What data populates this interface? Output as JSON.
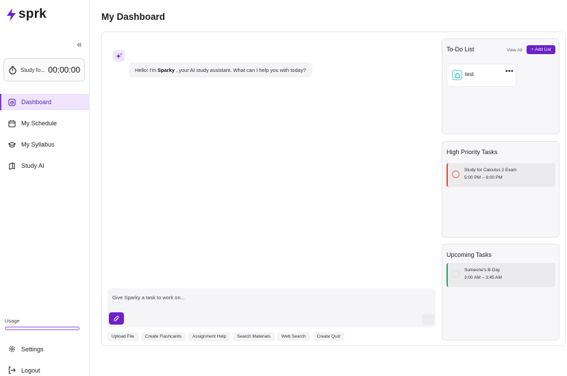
{
  "app": {
    "name": "sprk"
  },
  "sidebar": {
    "timer": {
      "label": "Study fo...",
      "value": "00:00:00"
    },
    "items": [
      {
        "label": "Dashboard",
        "icon": "dashboard-icon",
        "active": true
      },
      {
        "label": "My Schedule",
        "icon": "calendar-icon",
        "active": false
      },
      {
        "label": "My Syllabus",
        "icon": "graduation-cap-icon",
        "active": false
      },
      {
        "label": "Study AI",
        "icon": "book-icon",
        "active": false
      }
    ],
    "usage": {
      "label": "Usage",
      "fraction": 0.0
    },
    "settings_label": "Settings",
    "logout_label": "Logout"
  },
  "page": {
    "title": "My Dashboard"
  },
  "chat": {
    "greeting_prefix": "Hello! I'm",
    "assistant_name": "Sparky",
    "greeting_suffix": ", your AI study assistant. What can I help you with today?",
    "input_placeholder": "Give Sparky a task to work on...",
    "quick_actions": [
      "Upload File",
      "Create Flashcards",
      "Assignment Help",
      "Search Materials",
      "Web Search",
      "Create Quiz"
    ]
  },
  "todo": {
    "title": "To-Do List",
    "view_all_label": "View All",
    "add_list_label": "Add List",
    "lists": [
      {
        "name": "test"
      }
    ]
  },
  "high_priority": {
    "title": "High Priority Tasks",
    "tasks": [
      {
        "title": "Study for Calculus 2 Exam",
        "time": "5:00 PM – 8:00 PM"
      }
    ]
  },
  "upcoming": {
    "title": "Upcoming Tasks",
    "tasks": [
      {
        "title": "Someone's B-Day",
        "time": "3:00 AM – 3:45 AM"
      }
    ]
  },
  "colors": {
    "accent": "#6b21c8",
    "active_bg": "#efe4fc",
    "priority": "#e24c3a",
    "upcoming": "#2aa55b"
  }
}
